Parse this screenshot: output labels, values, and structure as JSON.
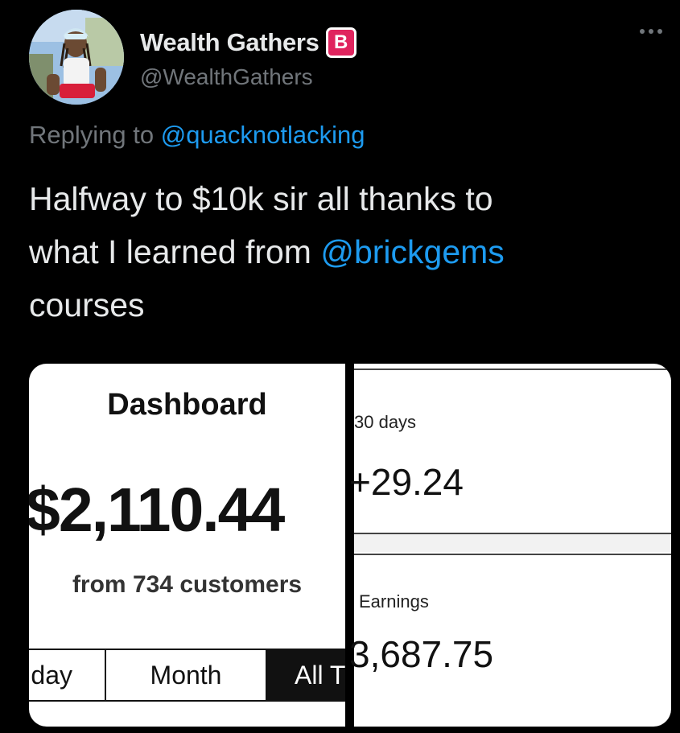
{
  "tweet": {
    "display_name": "Wealth Gathers",
    "badge": "B",
    "handle": "@WealthGathers",
    "replying_prefix": "Replying to",
    "replying_to": "@quacknotlacking",
    "text_line1": "Halfway to $10k sir all thanks to",
    "text_line2_prefix": "what I learned from",
    "text_mention": "@brickgems",
    "text_line3": "courses",
    "more_icon": "ellipsis-icon",
    "colors": {
      "mention": "#1d9bf0",
      "badge": "#e0245e",
      "muted": "#71767b"
    }
  },
  "media": {
    "left_panel": {
      "title": "Dashboard",
      "amount": "$2,110.44",
      "subtitle": "from 734 customers",
      "tabs": [
        "day",
        "Month",
        "All T"
      ],
      "active_tab": "All T"
    },
    "right_panel": {
      "period_label": "30 days",
      "period_value": "+29.24",
      "earnings_label": "Earnings",
      "earnings_value": "3,687.75"
    }
  }
}
